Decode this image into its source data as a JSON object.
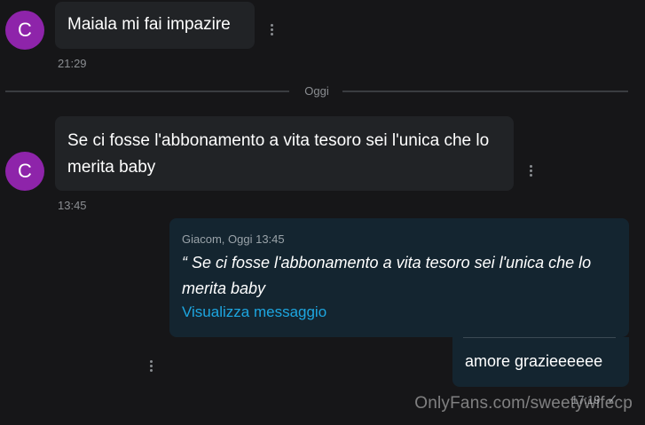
{
  "messages": [
    {
      "avatar_letter": "C",
      "text": "Maiala mi fai impazire",
      "time": "21:29"
    },
    {
      "avatar_letter": "C",
      "text": "Se ci fosse l'abbonamento a vita tesoro sei l'unica che lo merita baby",
      "time": "13:45"
    }
  ],
  "day_divider": "Oggi",
  "reply": {
    "quote_meta": "Giacom, Oggi 13:45",
    "quote_text": "“ Se ci fosse l'abbonamento a vita tesoro sei l'unica che lo merita baby",
    "view_link": "Visualizza messaggio",
    "text": "amore grazieeeeee",
    "time": "17:19",
    "status_icon": "check-icon"
  },
  "watermark": "OnlyFans.com/sweetywifecp",
  "colors": {
    "avatar": "#8e24aa",
    "incoming_bubble": "#212326",
    "outgoing_bubble": "#142530",
    "link": "#1da6e0"
  }
}
